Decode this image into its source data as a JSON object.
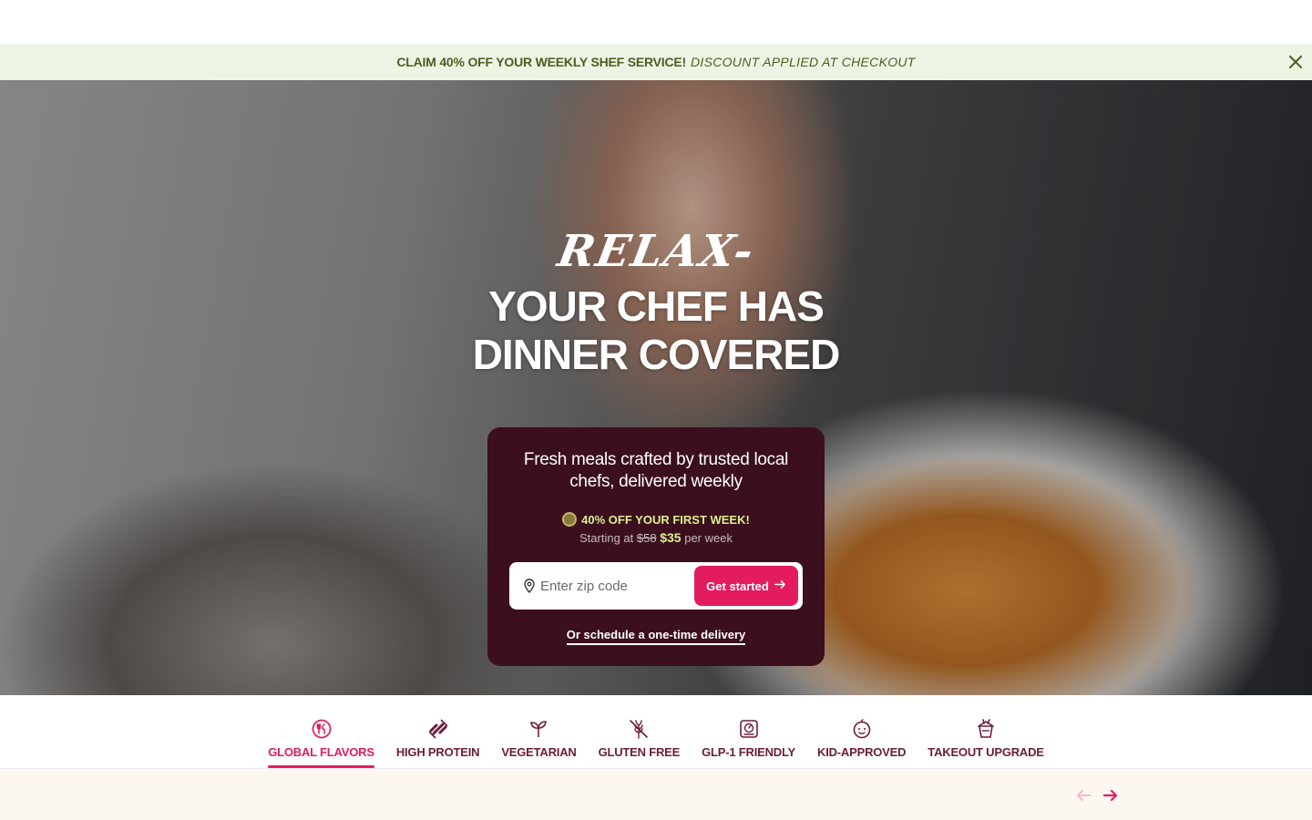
{
  "promo": {
    "main": "CLAIM 40% OFF YOUR WEEKLY SHEF SERVICE!",
    "sub": "DISCOUNT APPLIED AT CHECKOUT",
    "close_icon": "close-icon"
  },
  "hero": {
    "script_word": "RELAX-",
    "title_line1": "YOUR CHEF HAS",
    "title_line2": "DINNER COVERED"
  },
  "card": {
    "description": "Fresh meals crafted by trusted local chefs, delivered weekly",
    "offer": "40% OFF YOUR FIRST WEEK!",
    "price_prefix": "Starting at",
    "price_old": "$58",
    "price_new": "$35",
    "price_suffix": "per week",
    "zip_placeholder": "Enter zip code",
    "cta_label": "Get started",
    "onetime_link": "Or schedule a one-time delivery"
  },
  "categories": [
    {
      "label": "GLOBAL FLAVORS",
      "icon": "globe-utensils-icon",
      "active": true
    },
    {
      "label": "HIGH PROTEIN",
      "icon": "dumbbell-icon",
      "active": false
    },
    {
      "label": "VEGETARIAN",
      "icon": "sprout-icon",
      "active": false
    },
    {
      "label": "GLUTEN FREE",
      "icon": "wheat-off-icon",
      "active": false
    },
    {
      "label": "GLP-1 FRIENDLY",
      "icon": "scale-icon",
      "active": false
    },
    {
      "label": "KID-APPROVED",
      "icon": "kid-face-icon",
      "active": false
    },
    {
      "label": "TAKEOUT UPGRADE",
      "icon": "takeout-box-icon",
      "active": false
    }
  ],
  "carousel": {
    "prev_icon": "arrow-left-icon",
    "next_icon": "arrow-right-icon"
  },
  "colors": {
    "accent": "#e31c5f",
    "card_bg": "#3b0f1e",
    "promo_bg": "#eef4e4",
    "offer_green": "#dcef8c"
  }
}
